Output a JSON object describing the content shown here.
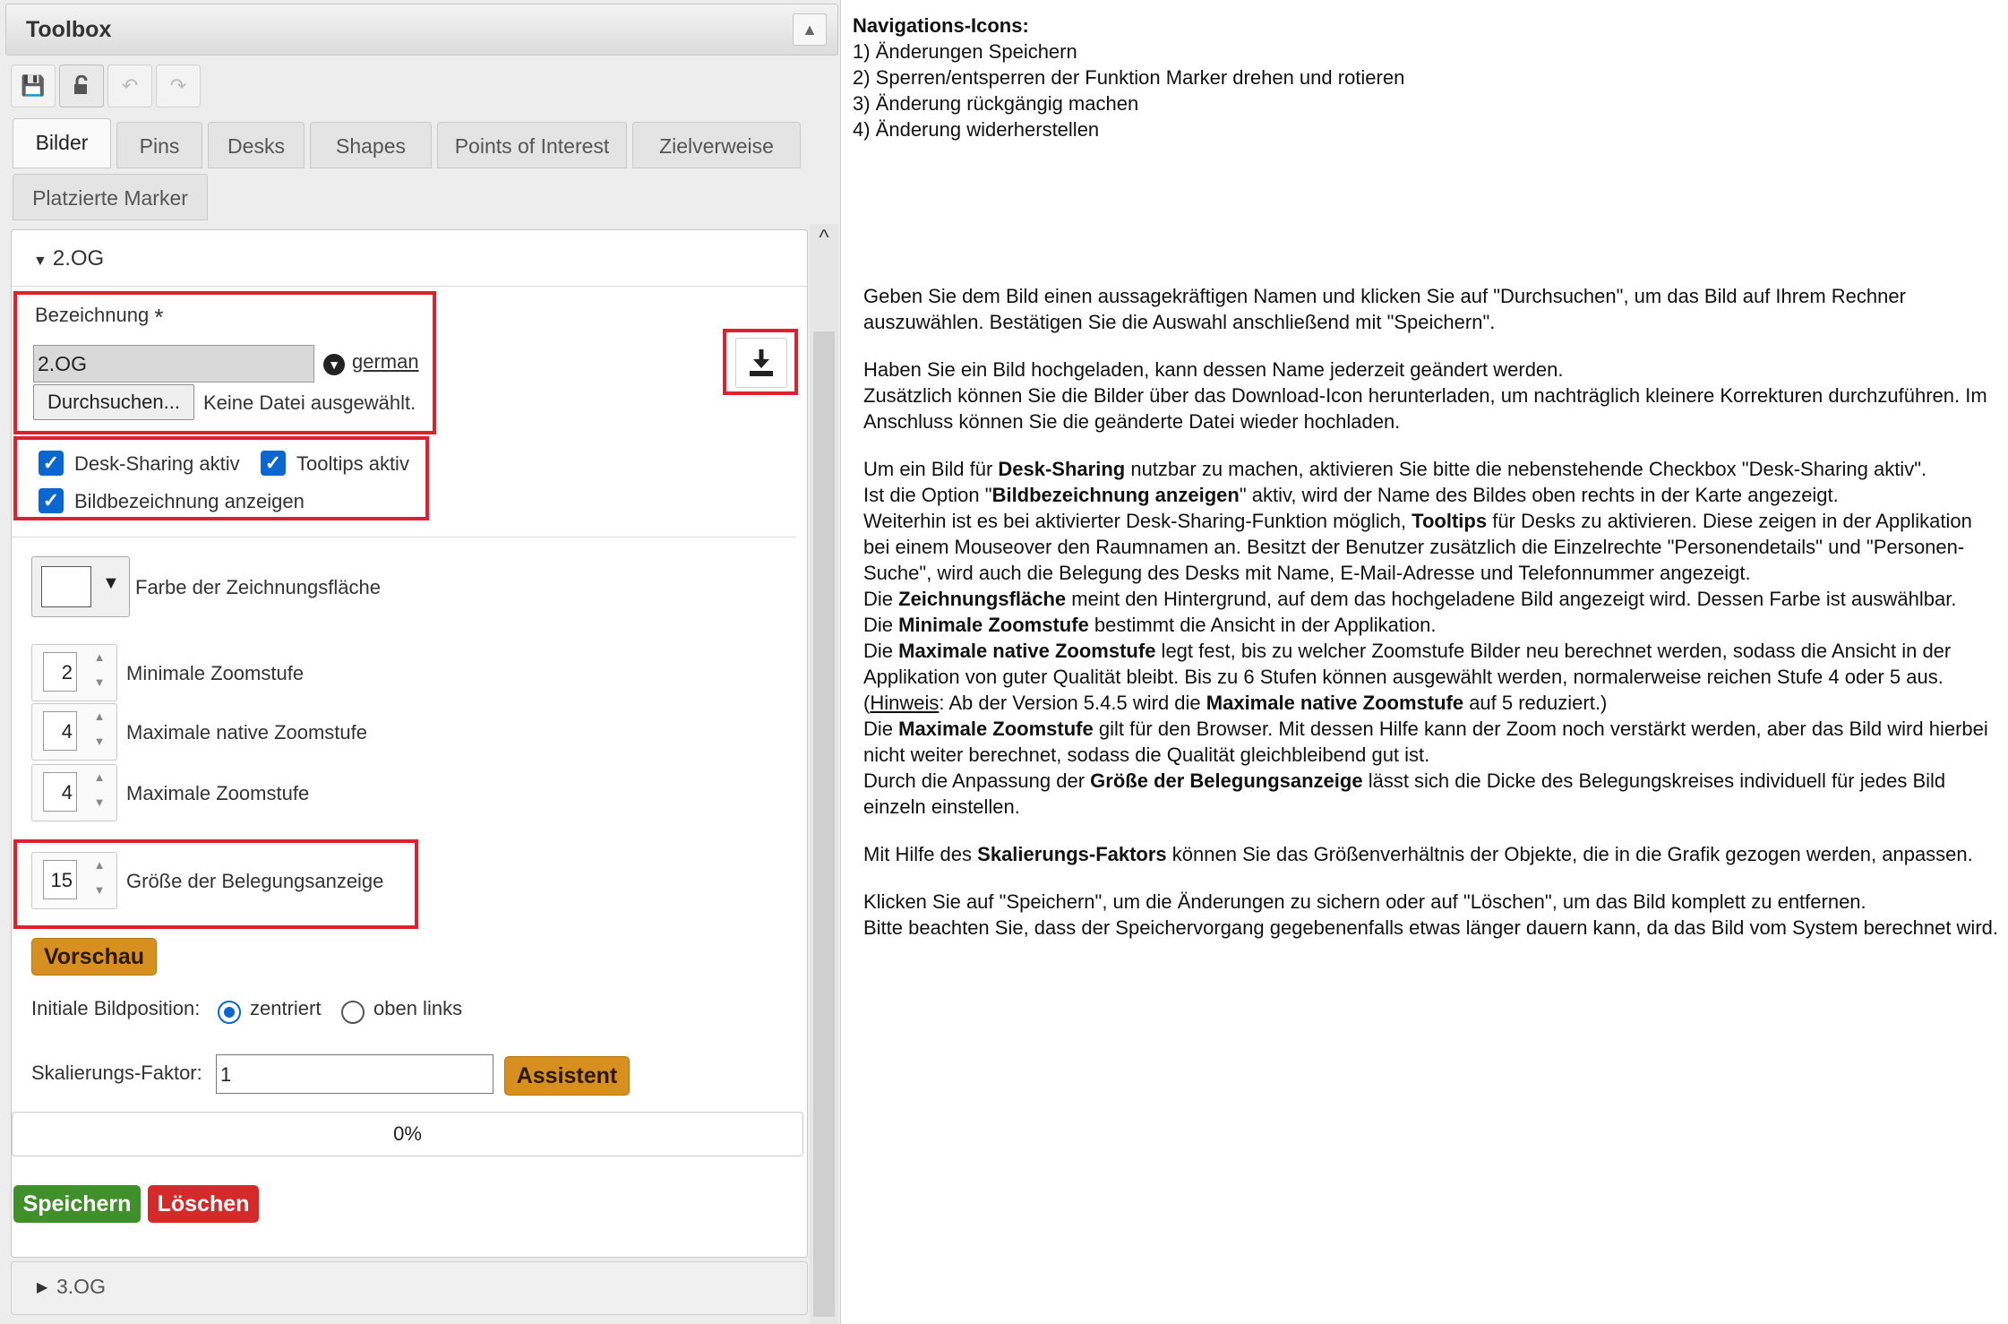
{
  "toolbox": {
    "title": "Toolbox",
    "collapse_icon": "chevron-up-icon",
    "nav_icons": [
      "save-icon",
      "lock-icon",
      "undo-icon",
      "redo-icon"
    ],
    "tabs": [
      "Bilder",
      "Pins",
      "Desks",
      "Shapes",
      "Points of Interest",
      "Zielverweise",
      "Platzierte Marker"
    ],
    "selected_tab": "Bilder"
  },
  "section_open": {
    "title": "2.OG"
  },
  "section_closed": {
    "title": "3.OG"
  },
  "form": {
    "name_label": "Bezeichnung",
    "required_mark": "*",
    "name_value": "2.OG",
    "language_link": "german",
    "browse_button": "Durchsuchen...",
    "file_status": "Keine Datei ausgewählt.",
    "download_icon": "download-icon",
    "checkboxes": [
      {
        "label": "Desk-Sharing aktiv",
        "checked": true
      },
      {
        "label": "Tooltips aktiv",
        "checked": true
      },
      {
        "label": "Bildbezeichnung anzeigen",
        "checked": true
      }
    ],
    "canvas_color_label": "Farbe der Zeichnungsfläche",
    "canvas_color": "#ffffff",
    "zoom": [
      {
        "label": "Minimale Zoomstufe",
        "value": "2"
      },
      {
        "label": "Maximale native Zoomstufe",
        "value": "4"
      },
      {
        "label": "Maximale Zoomstufe",
        "value": "4"
      }
    ],
    "occupancy": {
      "label": "Größe der Belegungsanzeige",
      "value": "15"
    },
    "preview_button": "Vorschau",
    "position_label": "Initiale Bildposition:",
    "position_options": [
      {
        "label": "zentriert",
        "selected": true
      },
      {
        "label": "oben links",
        "selected": false
      }
    ],
    "scale_label": "Skalierungs-Faktor:",
    "scale_value": "1",
    "assistant_button": "Assistent",
    "progress": "0%",
    "save_button": "Speichern",
    "delete_button": "Löschen"
  },
  "colors": {
    "highlight_red": "#e0202c",
    "checkbox_blue": "#0a67d0",
    "orange": "#d7901f",
    "save_green": "#3f8f2a",
    "delete_red": "#d42a2a"
  },
  "help": {
    "nav_title": "Navigations-Icons:",
    "nav_items": [
      "1) Änderungen Speichern",
      "2) Sperren/entsperren der Funktion Marker drehen und rotieren",
      "3) Änderung rückgängig machen",
      "4) Änderung widerherstellen"
    ],
    "p1": "Geben Sie dem Bild einen aussagekräftigen Namen und klicken Sie auf \"Durchsuchen\", um das Bild auf Ihrem Rechner auszuwählen. Bestätigen Sie die Auswahl anschließend mit \"Speichern\".",
    "p2a": "Haben Sie ein Bild hochgeladen, kann dessen Name jederzeit geändert werden.",
    "p2b": "Zusätzlich können Sie die Bilder über das Download-Icon herunterladen, um nachträglich kleinere Korrekturen durchzuführen. Im Anschluss können Sie die geänderte Datei wieder hochladen.",
    "p3": {
      "l1a": "Um ein Bild für ",
      "l1b": "Desk-Sharing",
      "l1c": " nutzbar zu machen, aktivieren Sie bitte die nebenstehende Checkbox \"Desk-Sharing aktiv\".",
      "l2a": "Ist die Option \"",
      "l2b": "Bildbezeichnung anzeigen",
      "l2c": "\" aktiv, wird der Name des Bildes oben rechts in der Karte angezeigt.",
      "l3a": "Weiterhin ist es bei aktivierter Desk-Sharing-Funktion möglich, ",
      "l3b": "Tooltips",
      "l3c": " für Desks zu aktivieren. Diese zeigen in der Applikation bei einem Mouseover den Raumnamen an. Besitzt der Benutzer zusätzlich die Einzelrechte \"Personendetails\" und \"Personen-Suche\", wird auch die Belegung des Desks mit Name, E-Mail-Adresse und Telefonnummer angezeigt.",
      "l4a": "Die ",
      "l4b": "Zeichnungsfläche",
      "l4c": " meint den Hintergrund, auf dem das hochgeladene Bild angezeigt wird. Dessen Farbe ist auswählbar.",
      "l5a": "Die ",
      "l5b": "Minimale Zoomstufe",
      "l5c": " bestimmt die Ansicht in der Applikation.",
      "l6a": "Die ",
      "l6b": "Maximale native Zoomstufe",
      "l6c": " legt fest, bis zu welcher Zoomstufe Bilder neu berechnet werden, sodass die Ansicht in der Applikation von guter Qualität bleibt. Bis zu 6 Stufen können ausgewählt werden, normalerweise reichen Stufe 4 oder 5 aus. (",
      "l6d": "Hinweis",
      "l6e": ": Ab der Version 5.4.5 wird die ",
      "l6f": "Maximale native Zoomstufe",
      "l6g": " auf 5 reduziert.)",
      "l7a": "Die ",
      "l7b": "Maximale Zoomstufe",
      "l7c": " gilt für den Browser. Mit dessen Hilfe kann der Zoom noch verstärkt werden, aber das Bild wird hierbei nicht weiter berechnet, sodass die Qualität gleichbleibend gut ist.",
      "l8a": "Durch die Anpassung der ",
      "l8b": "Größe der Belegungsanzeige",
      "l8c": " lässt sich die Dicke des Belegungskreises individuell für jedes Bild einzeln einstellen."
    },
    "p4a": "Mit Hilfe des ",
    "p4b": "Skalierungs-Faktors",
    "p4c": " können Sie das Größenverhältnis der Objekte, die in die Grafik gezogen werden, anpassen.",
    "p5a": "Klicken Sie auf \"Speichern\", um die Änderungen zu sichern oder auf \"Löschen\", um das Bild komplett zu entfernen.",
    "p5b": "Bitte beachten Sie, dass der Speichervorgang gegebenenfalls etwas länger dauern kann, da das Bild vom System berechnet wird."
  }
}
